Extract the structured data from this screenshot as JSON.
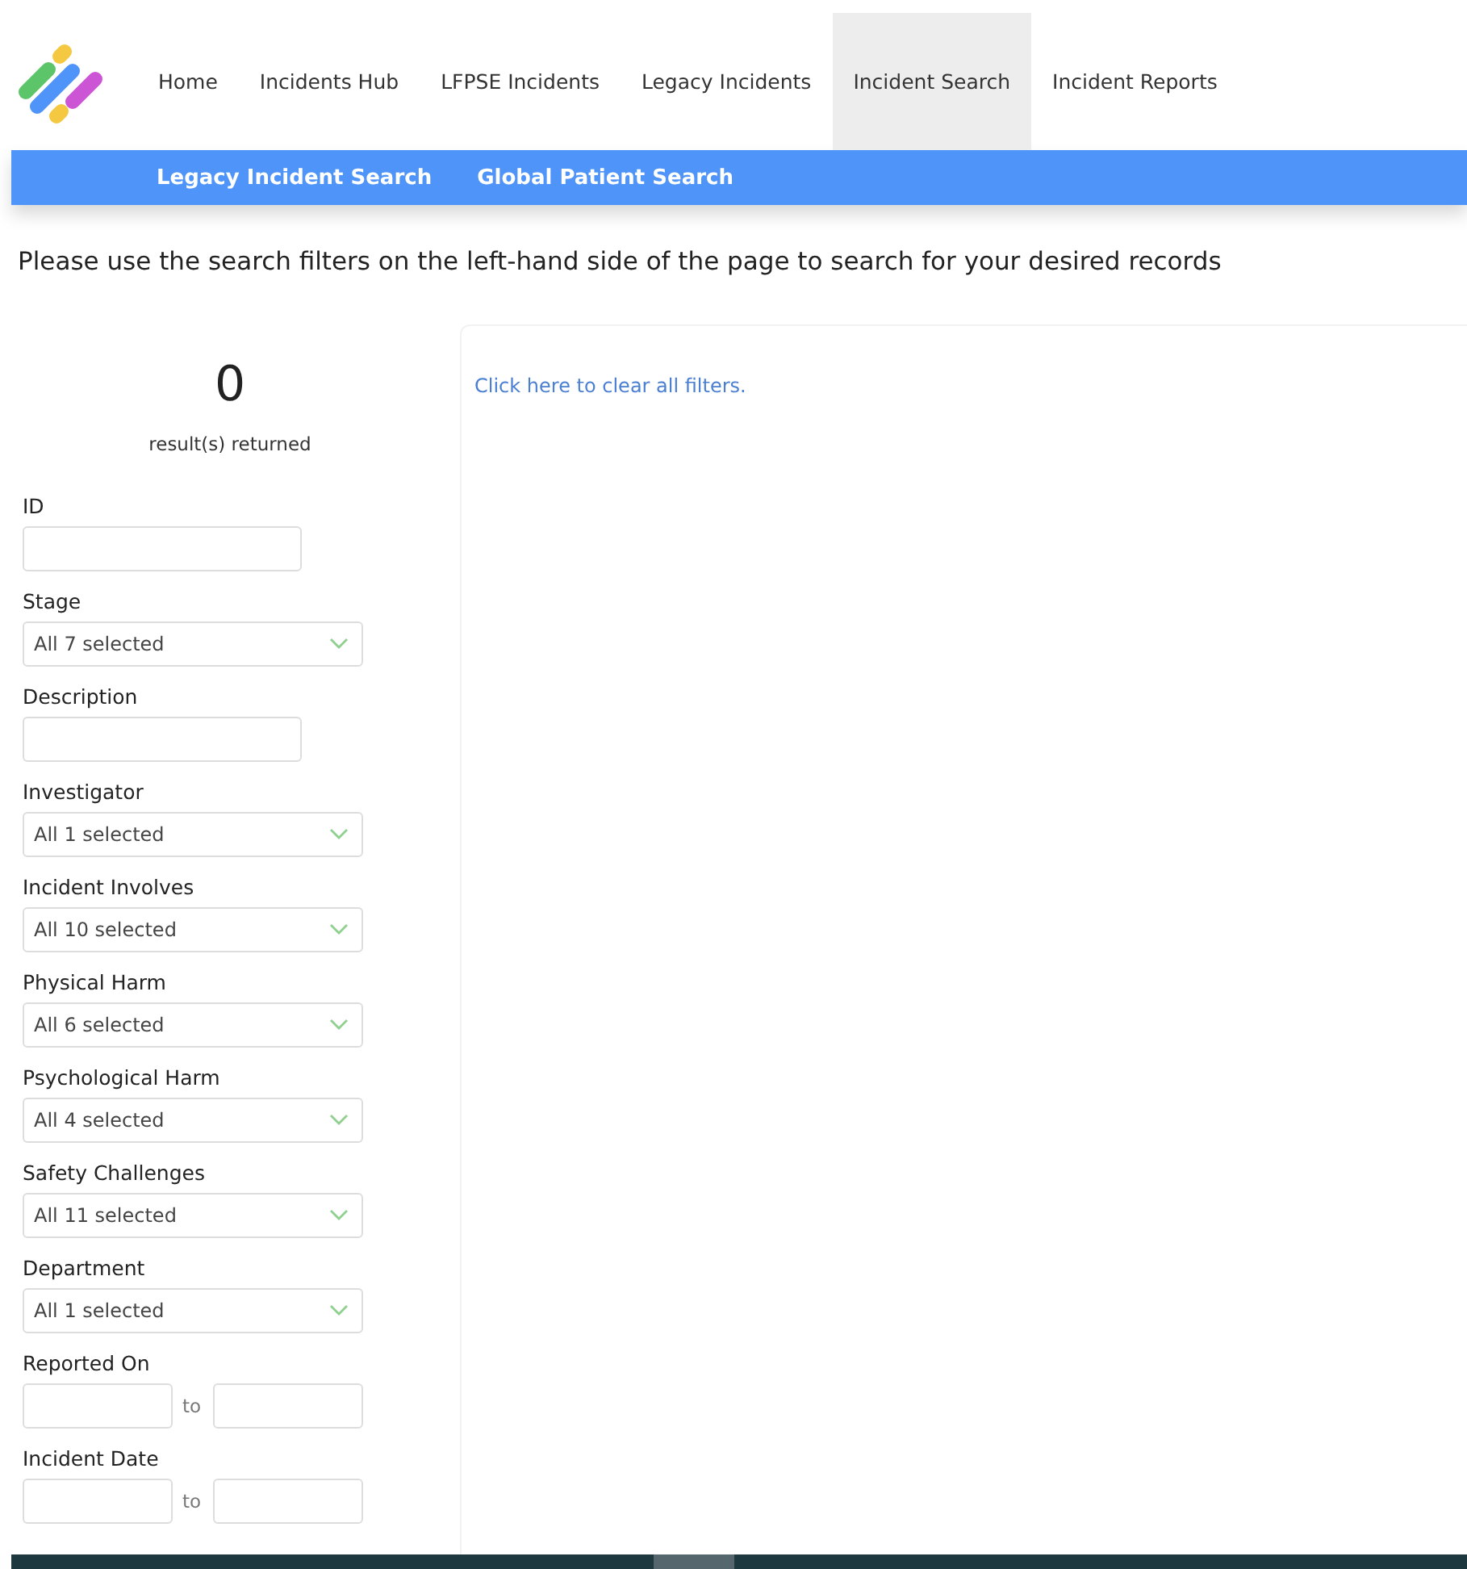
{
  "nav": {
    "items": [
      {
        "label": "Home",
        "selected": false
      },
      {
        "label": "Incidents Hub",
        "selected": false
      },
      {
        "label": "LFPSE Incidents",
        "selected": false
      },
      {
        "label": "Legacy Incidents",
        "selected": false
      },
      {
        "label": "Incident Search",
        "selected": true
      },
      {
        "label": "Incident Reports",
        "selected": false
      }
    ]
  },
  "subnav": {
    "items": [
      "Legacy Incident Search",
      "Global Patient Search"
    ]
  },
  "intro": "Please use the search filters on the left-hand side of the page to search for your desired records",
  "results": {
    "count": "0",
    "label": "result(s) returned"
  },
  "filters": [
    {
      "kind": "text",
      "label": "ID"
    },
    {
      "kind": "select",
      "label": "Stage",
      "value": "All 7 selected"
    },
    {
      "kind": "text",
      "label": "Description"
    },
    {
      "kind": "select",
      "label": "Investigator",
      "value": "All 1 selected"
    },
    {
      "kind": "select",
      "label": "Incident Involves",
      "value": "All 10 selected"
    },
    {
      "kind": "select",
      "label": "Physical Harm",
      "value": "All 6 selected"
    },
    {
      "kind": "select",
      "label": "Psychological Harm",
      "value": "All 4 selected"
    },
    {
      "kind": "select",
      "label": "Safety Challenges",
      "value": "All 11 selected"
    },
    {
      "kind": "select",
      "label": "Department",
      "value": "All 1 selected"
    },
    {
      "kind": "daterange",
      "label": "Reported On",
      "separator": "to"
    },
    {
      "kind": "daterange",
      "label": "Incident Date",
      "separator": "to"
    }
  ],
  "clear_link": "Click here to clear all filters."
}
